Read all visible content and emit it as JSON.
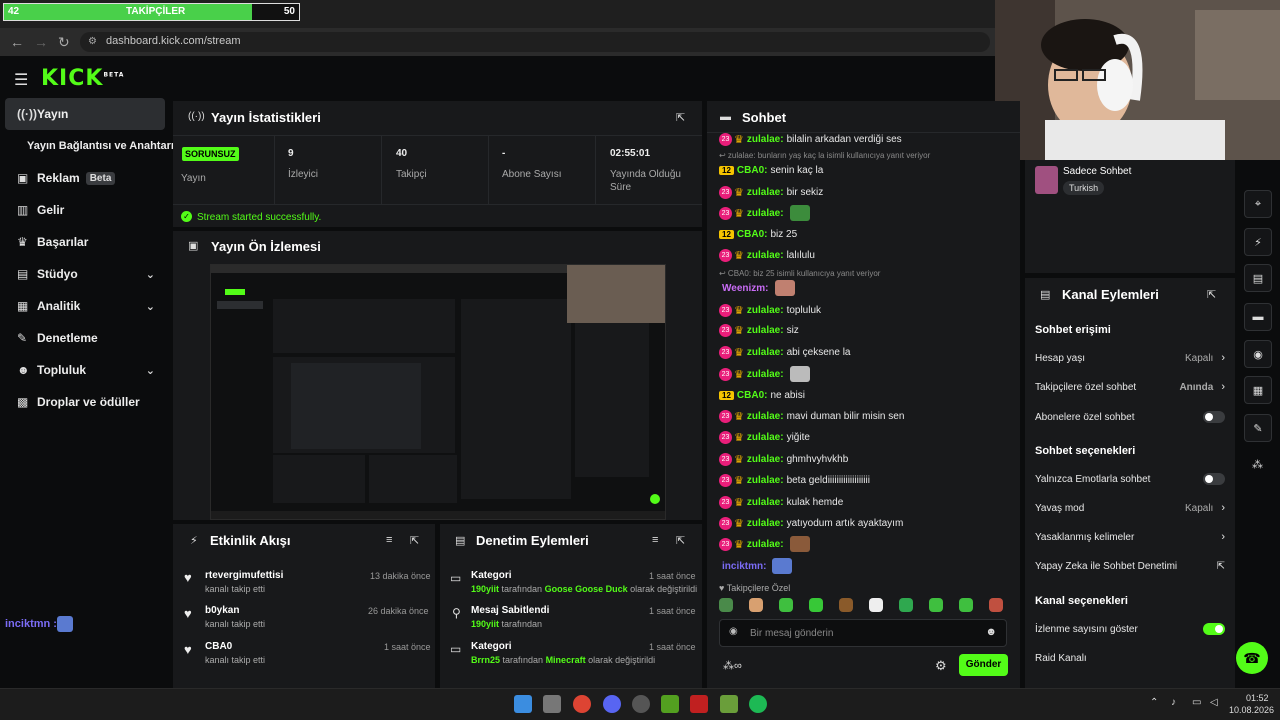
{
  "overlay": {
    "follow_current": "42",
    "follow_label": "TAKİPÇİLER",
    "follow_goal": "50",
    "progress": 0.84
  },
  "browser": {
    "url": "dashboard.kick.com/stream"
  },
  "sidebar": {
    "items": [
      {
        "label": "Yayın",
        "icon": "broadcast-icon"
      },
      {
        "label": "Yayın Bağlantısı ve Anahtarı"
      },
      {
        "label": "Reklam",
        "badge": "Beta",
        "icon": "ad-icon"
      },
      {
        "label": "Gelir",
        "icon": "chart-icon"
      },
      {
        "label": "Başarılar",
        "icon": "trophy-icon"
      },
      {
        "label": "Stüdyo",
        "icon": "studio-icon"
      },
      {
        "label": "Analitik",
        "icon": "analytics-icon"
      },
      {
        "label": "Denetleme",
        "icon": "wrench-icon"
      },
      {
        "label": "Topluluk",
        "icon": "people-icon"
      },
      {
        "label": "Droplar ve ödüller",
        "icon": "gift-icon"
      }
    ],
    "viewer_user": "inciktmn :"
  },
  "stats": {
    "title": "Yayın İstatistikleri",
    "status_badge": "SORUNSUZ",
    "status_label": "Yayın",
    "viewers_val": "9",
    "viewers_lbl": "İzleyici",
    "followers_val": "40",
    "followers_lbl": "Takipçi",
    "subs_val": "-",
    "subs_lbl": "Abone Sayısı",
    "uptime_val": "02:55:01",
    "uptime_lbl1": "Yayında Olduğu",
    "uptime_lbl2": "Süre",
    "success_msg": "Stream started successfully."
  },
  "preview": {
    "title": "Yayın Ön İzlemesi"
  },
  "activity": {
    "title": "Etkinlik Akışı",
    "items": [
      {
        "name": "rtevergimufettisi",
        "sub": "kanalı takip etti",
        "time": "13 dakika önce"
      },
      {
        "name": "b0ykan",
        "sub": "kanalı takip etti",
        "time": "26 dakika önce"
      },
      {
        "name": "CBA0",
        "sub": "kanalı takip etti",
        "time": "1 saat önce"
      }
    ]
  },
  "moderation": {
    "title": "Denetim Eylemleri",
    "items": [
      {
        "name": "Kategori",
        "user": "190yiit",
        "mid": " tarafından ",
        "target": "Goose Goose Duck",
        "end": " olarak değiştirildi",
        "time": "1 saat önce"
      },
      {
        "name": "Mesaj Sabitlendi",
        "user": "190yiit",
        "mid": " tarafından",
        "target": "",
        "end": "",
        "time": "1 saat önce"
      },
      {
        "name": "Kategori",
        "user": "Brrn25",
        "mid": " tarafından ",
        "target": "Minecraft",
        "end": " olarak değiştirildi",
        "time": "1 saat önce"
      }
    ]
  },
  "chat": {
    "title": "Sohbet",
    "lines": [
      {
        "user": "zulalae:",
        "text": "bilalin arkadan verdiği ses",
        "color": "#53fc18",
        "badge": "pink"
      },
      {
        "reply": "zulalae: bunların yaş kaç la isimli kullanıcıya yanıt veriyor"
      },
      {
        "user": "CBA0:",
        "text": "senin kaç la",
        "color": "#53fc18",
        "badge": "yellow"
      },
      {
        "user": "zulalae:",
        "text": "bir sekiz",
        "color": "#53fc18",
        "badge": "pink"
      },
      {
        "user": "zulalae:",
        "text": "",
        "color": "#53fc18",
        "badge": "pink",
        "emote": "#3c8c3c"
      },
      {
        "user": "CBA0:",
        "text": "biz 25",
        "color": "#53fc18",
        "badge": "yellow"
      },
      {
        "user": "zulalae:",
        "text": "lalılulu",
        "color": "#53fc18",
        "badge": "pink"
      },
      {
        "reply": "CBA0: biz 25 isimli kullanıcıya yanıt veriyor"
      },
      {
        "user": "Weenizm:",
        "text": "",
        "color": "#c86cf5",
        "badge": "none",
        "emote": "#c08070"
      },
      {
        "user": "zulalae:",
        "text": "topluluk",
        "color": "#53fc18",
        "badge": "pink"
      },
      {
        "user": "zulalae:",
        "text": "siz",
        "color": "#53fc18",
        "badge": "pink"
      },
      {
        "user": "zulalae:",
        "text": "abi çeksene la",
        "color": "#53fc18",
        "badge": "pink"
      },
      {
        "user": "zulalae:",
        "text": "",
        "color": "#53fc18",
        "badge": "pink",
        "emote": "#bbbbbb"
      },
      {
        "user": "CBA0:",
        "text": "ne abisi",
        "color": "#53fc18",
        "badge": "yellow"
      },
      {
        "user": "zulalae:",
        "text": "mavi duman bilir misin sen",
        "color": "#53fc18",
        "badge": "pink"
      },
      {
        "user": "zulalae:",
        "text": "yiğite",
        "color": "#53fc18",
        "badge": "pink"
      },
      {
        "user": "zulalae:",
        "text": "ghmhvyhvkhb",
        "color": "#53fc18",
        "badge": "pink"
      },
      {
        "user": "zulalae:",
        "text": "beta geldiiiiiiiiiiiiiiiiiii",
        "color": "#53fc18",
        "badge": "pink"
      },
      {
        "user": "zulalae:",
        "text": "kulak hemde",
        "color": "#53fc18",
        "badge": "pink"
      },
      {
        "user": "zulalae:",
        "text": "yatıyodum artık ayaktayım",
        "color": "#53fc18",
        "badge": "pink"
      },
      {
        "user": "zulalae:",
        "text": "",
        "color": "#53fc18",
        "badge": "pink",
        "emote": "#8a5a3a"
      },
      {
        "user": "inciktmn:",
        "text": "",
        "color": "#7b6cf5",
        "badge": "none",
        "emote": "#5a7ad0"
      }
    ],
    "followers_only": "Takipçilere Özel",
    "input_placeholder": "Bir mesaj gönderin",
    "send_label": "Gönder"
  },
  "channel_info": {
    "mode": "Sadece Sohbet",
    "language": "Turkish"
  },
  "channel_actions": {
    "title": "Kanal Eylemleri",
    "chat_access": "Sohbet erişimi",
    "account_age": "Hesap yaşı",
    "account_age_val": "Kapalı",
    "followers_chat": "Takipçilere özel sohbet",
    "followers_chat_val": "Anında",
    "subs_chat": "Abonelere özel sohbet",
    "chat_options": "Sohbet seçenekleri",
    "emote_only": "Yalnızca Emotlarla sohbet",
    "slow_mode": "Yavaş mod",
    "slow_mode_val": "Kapalı",
    "banned_words": "Yasaklanmış kelimeler",
    "ai_mod": "Yapay Zeka ile Sohbet Denetimi",
    "channel_options": "Kanal seçenekleri",
    "show_viewers": "İzlenme sayısını göster",
    "raid": "Raid Kanalı"
  },
  "taskbar": {
    "time": "01:52",
    "date": "10.08.2026"
  },
  "colors": {
    "accent": "#53fc18",
    "panel": "#18191b",
    "bg": "#0b0c0d"
  }
}
